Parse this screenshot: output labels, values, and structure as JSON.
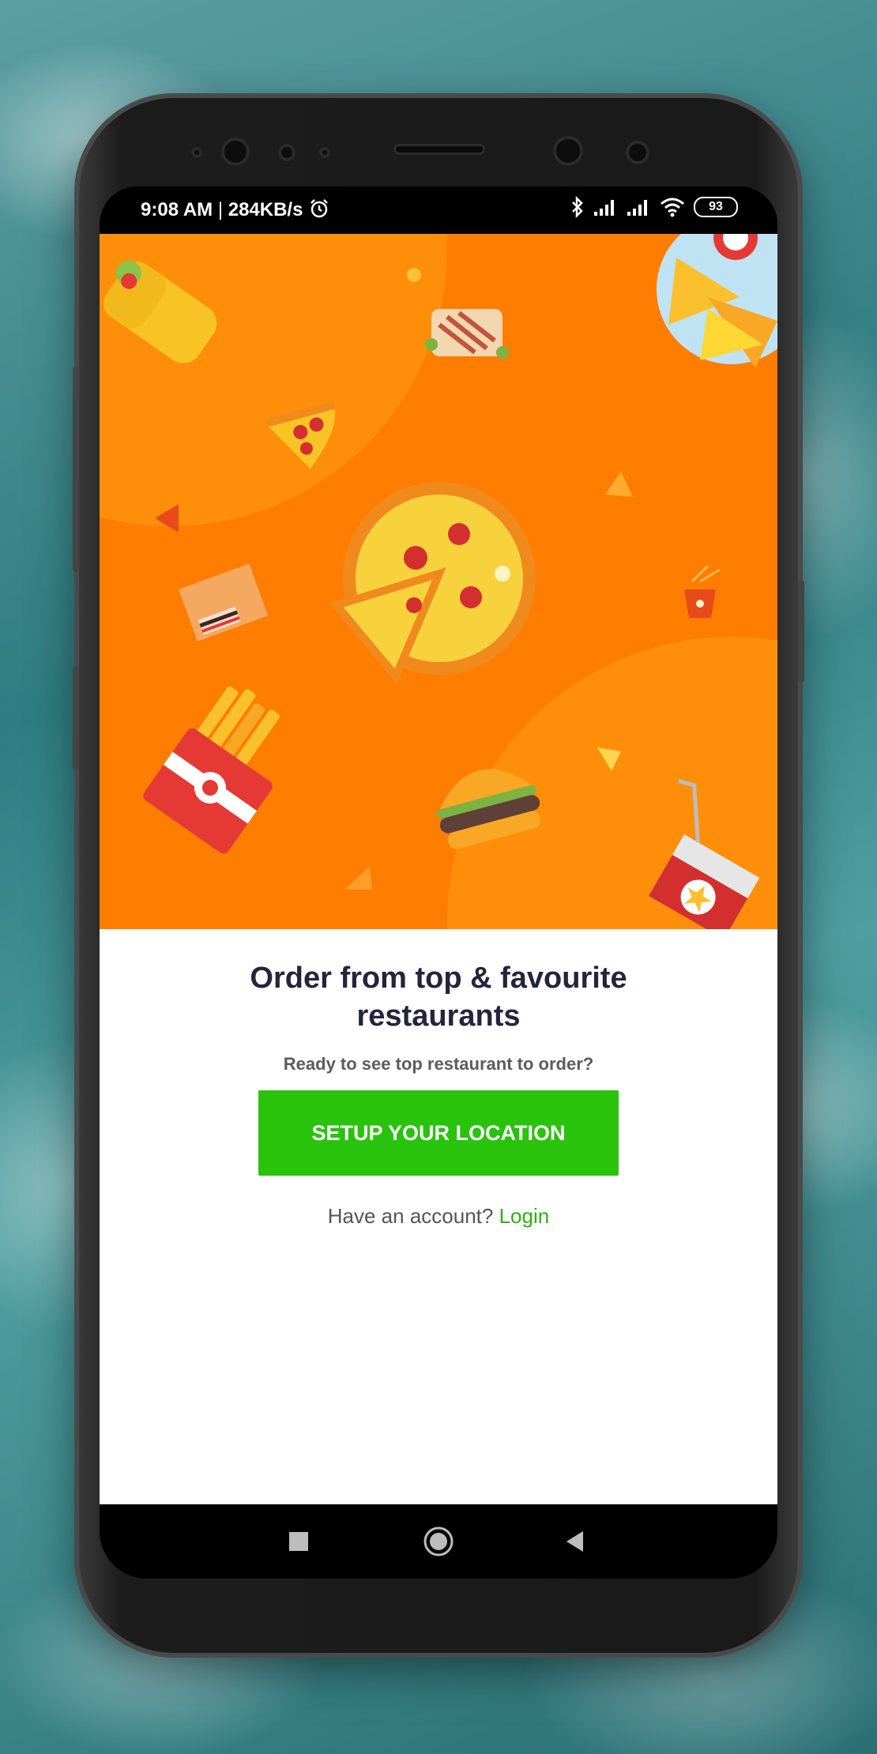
{
  "status_bar": {
    "time": "9:08 AM",
    "separator": "|",
    "speed": "284KB/s",
    "battery": "93",
    "icons": [
      "alarm-icon",
      "bluetooth-icon",
      "signal-icon",
      "signal-icon",
      "wifi-icon",
      "battery-icon"
    ]
  },
  "onboarding": {
    "headline_line1": "Order from top & favourite",
    "headline_line2": "restaurants",
    "subtitle": "Ready to see top restaurant to order?",
    "cta_label": "SETUP YOUR LOCATION",
    "account_prompt": "Have an account?",
    "login_label": "Login"
  },
  "nav_bar": {
    "buttons": [
      "recents-button",
      "home-button",
      "back-button"
    ]
  },
  "colors": {
    "hero_orange": "#ff7d00",
    "cta_green": "#28c30a",
    "login_green": "#2fae14",
    "headline": "#23253a"
  }
}
